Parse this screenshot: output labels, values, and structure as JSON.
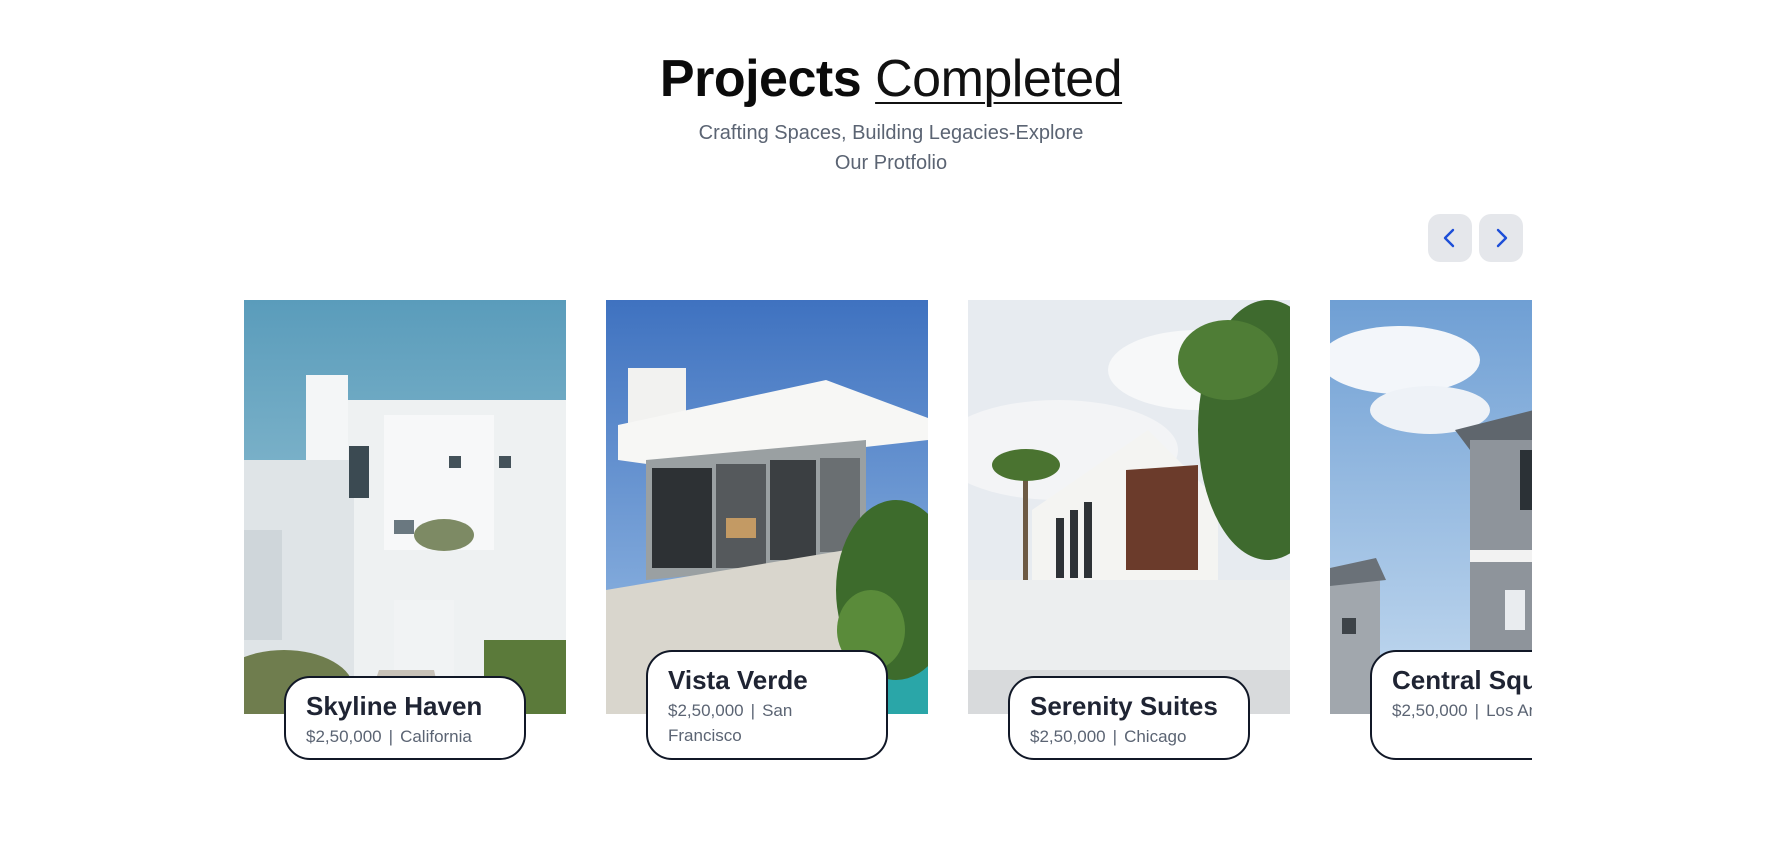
{
  "header": {
    "title_bold": "Projects",
    "title_light": "Completed",
    "subtitle": "Crafting Spaces, Building Legacies-Explore Our Protfolio"
  },
  "nav": {
    "prev_icon": "chevron-left-icon",
    "next_icon": "chevron-right-icon",
    "accent": "#1d4ed8"
  },
  "projects": [
    {
      "name": "Skyline Haven",
      "price": "$2,50,000",
      "location": "California"
    },
    {
      "name": "Vista Verde",
      "price": "$2,50,000",
      "location": "San Francisco"
    },
    {
      "name": "Serenity Suites",
      "price": "$2,50,000",
      "location": "Chicago"
    },
    {
      "name": "Central Square",
      "price": "$2,50,000",
      "location": "Los Angeles"
    }
  ]
}
